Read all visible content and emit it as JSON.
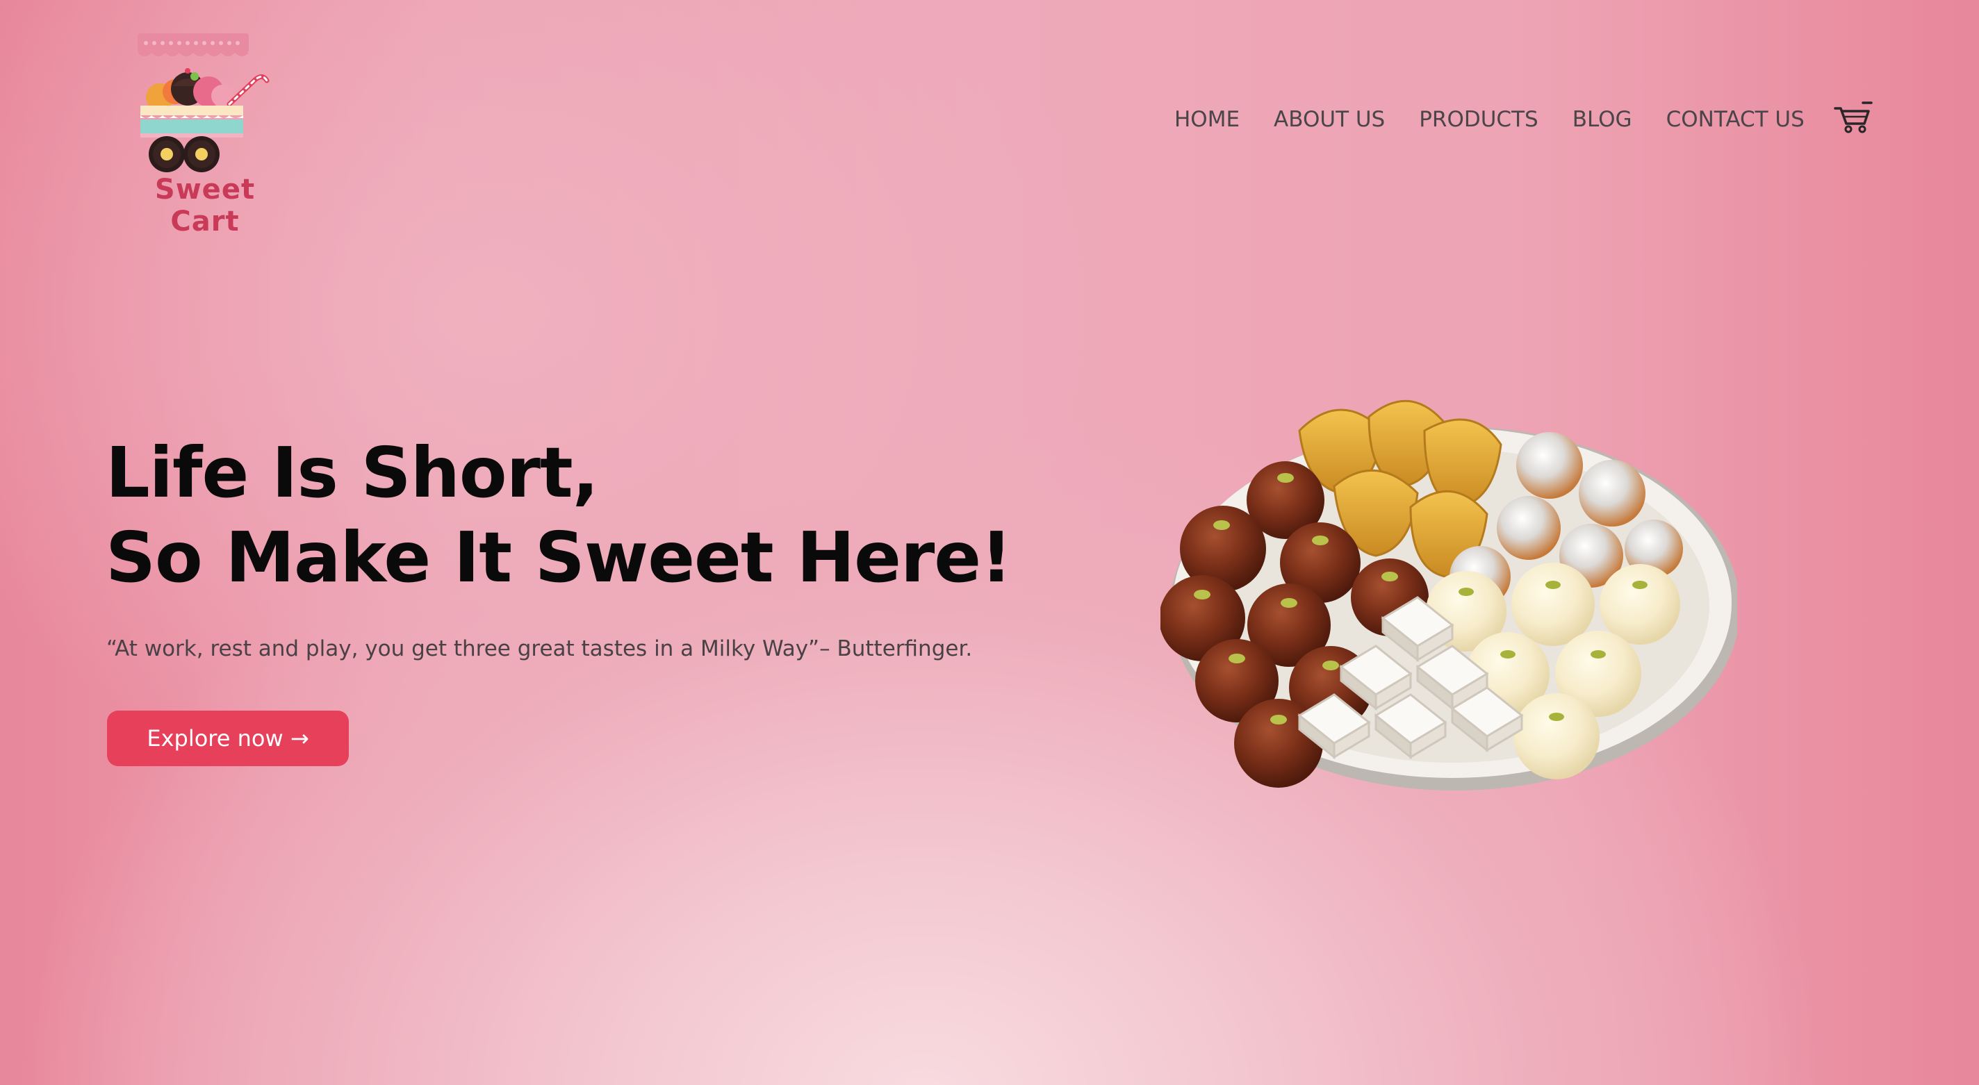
{
  "brand": {
    "name": "Sweet Cart",
    "logo_icon": "sweet-cart-logo"
  },
  "nav": {
    "items": [
      {
        "label": "HOME"
      },
      {
        "label": "ABOUT US"
      },
      {
        "label": "PRODUCTS"
      },
      {
        "label": "BLOG"
      },
      {
        "label": "CONTACT US"
      }
    ],
    "cart_icon": "shopping-cart-icon"
  },
  "hero": {
    "title_line1": "Life Is Short,",
    "title_line2": "So Make It Sweet Here!",
    "quote": "“At work, rest and play, you get three great tastes in a Milky Way”– Butterfinger.",
    "button_label": "Explore now →"
  },
  "image": {
    "subject": "plate-of-indian-sweets"
  },
  "colors": {
    "accent": "#e7405a",
    "brand_text": "#c93a58",
    "title_text": "#0b0a0b",
    "nav_text": "#4b4449",
    "background": "#eeaaba"
  }
}
